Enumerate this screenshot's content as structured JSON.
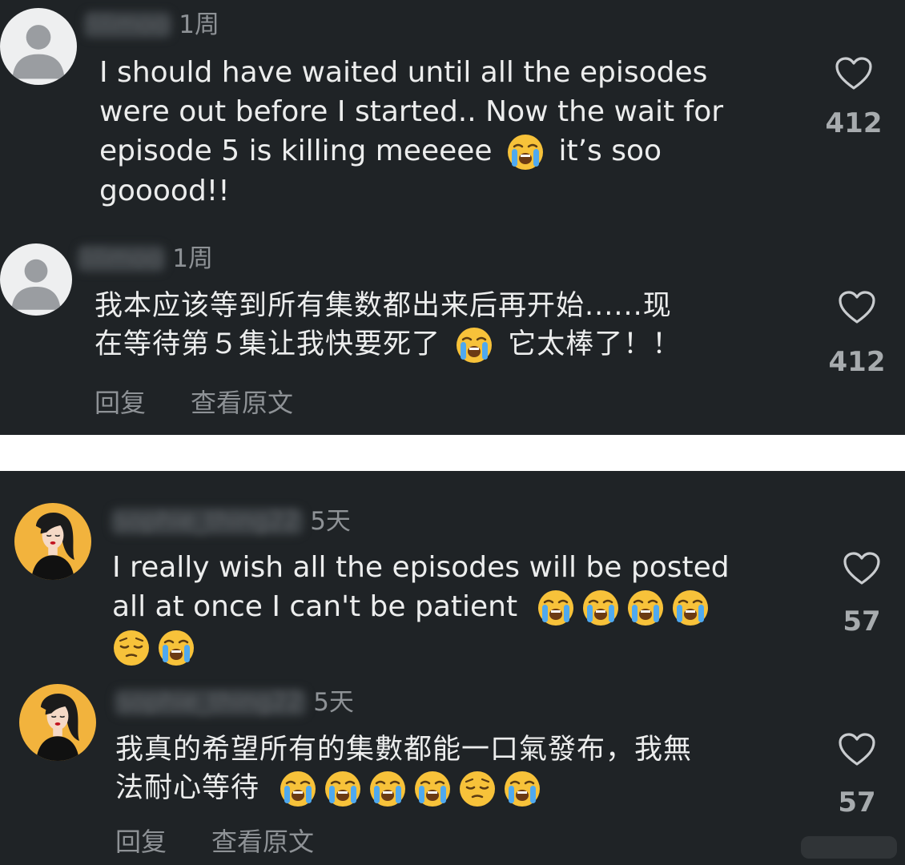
{
  "panels": [
    {
      "comments": [
        {
          "username": "lilimoo",
          "time": "1周",
          "text_lines": [
            "I should have waited until all the episodes",
            "were out before I started.. Now the wait for"
          ],
          "line3_before": "episode 5 is killing meeeee",
          "line3_after": "it’s soo",
          "line4": "gooood!!",
          "likes": "412",
          "emojis": [
            "loudly-crying-face"
          ]
        },
        {
          "username": "lilimoo",
          "time": "1周",
          "line1": "我本应该等到所有集数都出来后再开始......现",
          "line2_before": "在等待第５集让我快要死了",
          "line2_after": "它太棒了！！",
          "likes": "412",
          "emojis": [
            "loudly-crying-face"
          ]
        }
      ],
      "actions": {
        "reply": "回复",
        "view_original": "查看原文"
      }
    },
    {
      "comments": [
        {
          "username": "sophie_thing22",
          "time": "5天",
          "line1": "I really wish all the episodes will be posted",
          "line2": "all at once I can't be patient",
          "likes": "57",
          "emojis_line2": [
            "loudly-crying-face",
            "loudly-crying-face",
            "loudly-crying-face",
            "loudly-crying-face"
          ],
          "emojis_line3": [
            "pensive-face",
            "loudly-crying-face"
          ]
        },
        {
          "username": "sophie_thing22",
          "time": "5天",
          "line1": "我真的希望所有的集數都能一口氣發布，我無",
          "line2": "法耐心等待",
          "likes": "57",
          "emojis_line2": [
            "loudly-crying-face",
            "loudly-crying-face",
            "loudly-crying-face",
            "loudly-crying-face",
            "pensive-face",
            "loudly-crying-face"
          ]
        }
      ],
      "actions": {
        "reply": "回复",
        "view_original": "查看原文"
      }
    }
  ],
  "colors": {
    "background": "#1f2326",
    "text": "#eceded",
    "muted": "#8e9296",
    "avatar_bg": "#f2b33d"
  }
}
